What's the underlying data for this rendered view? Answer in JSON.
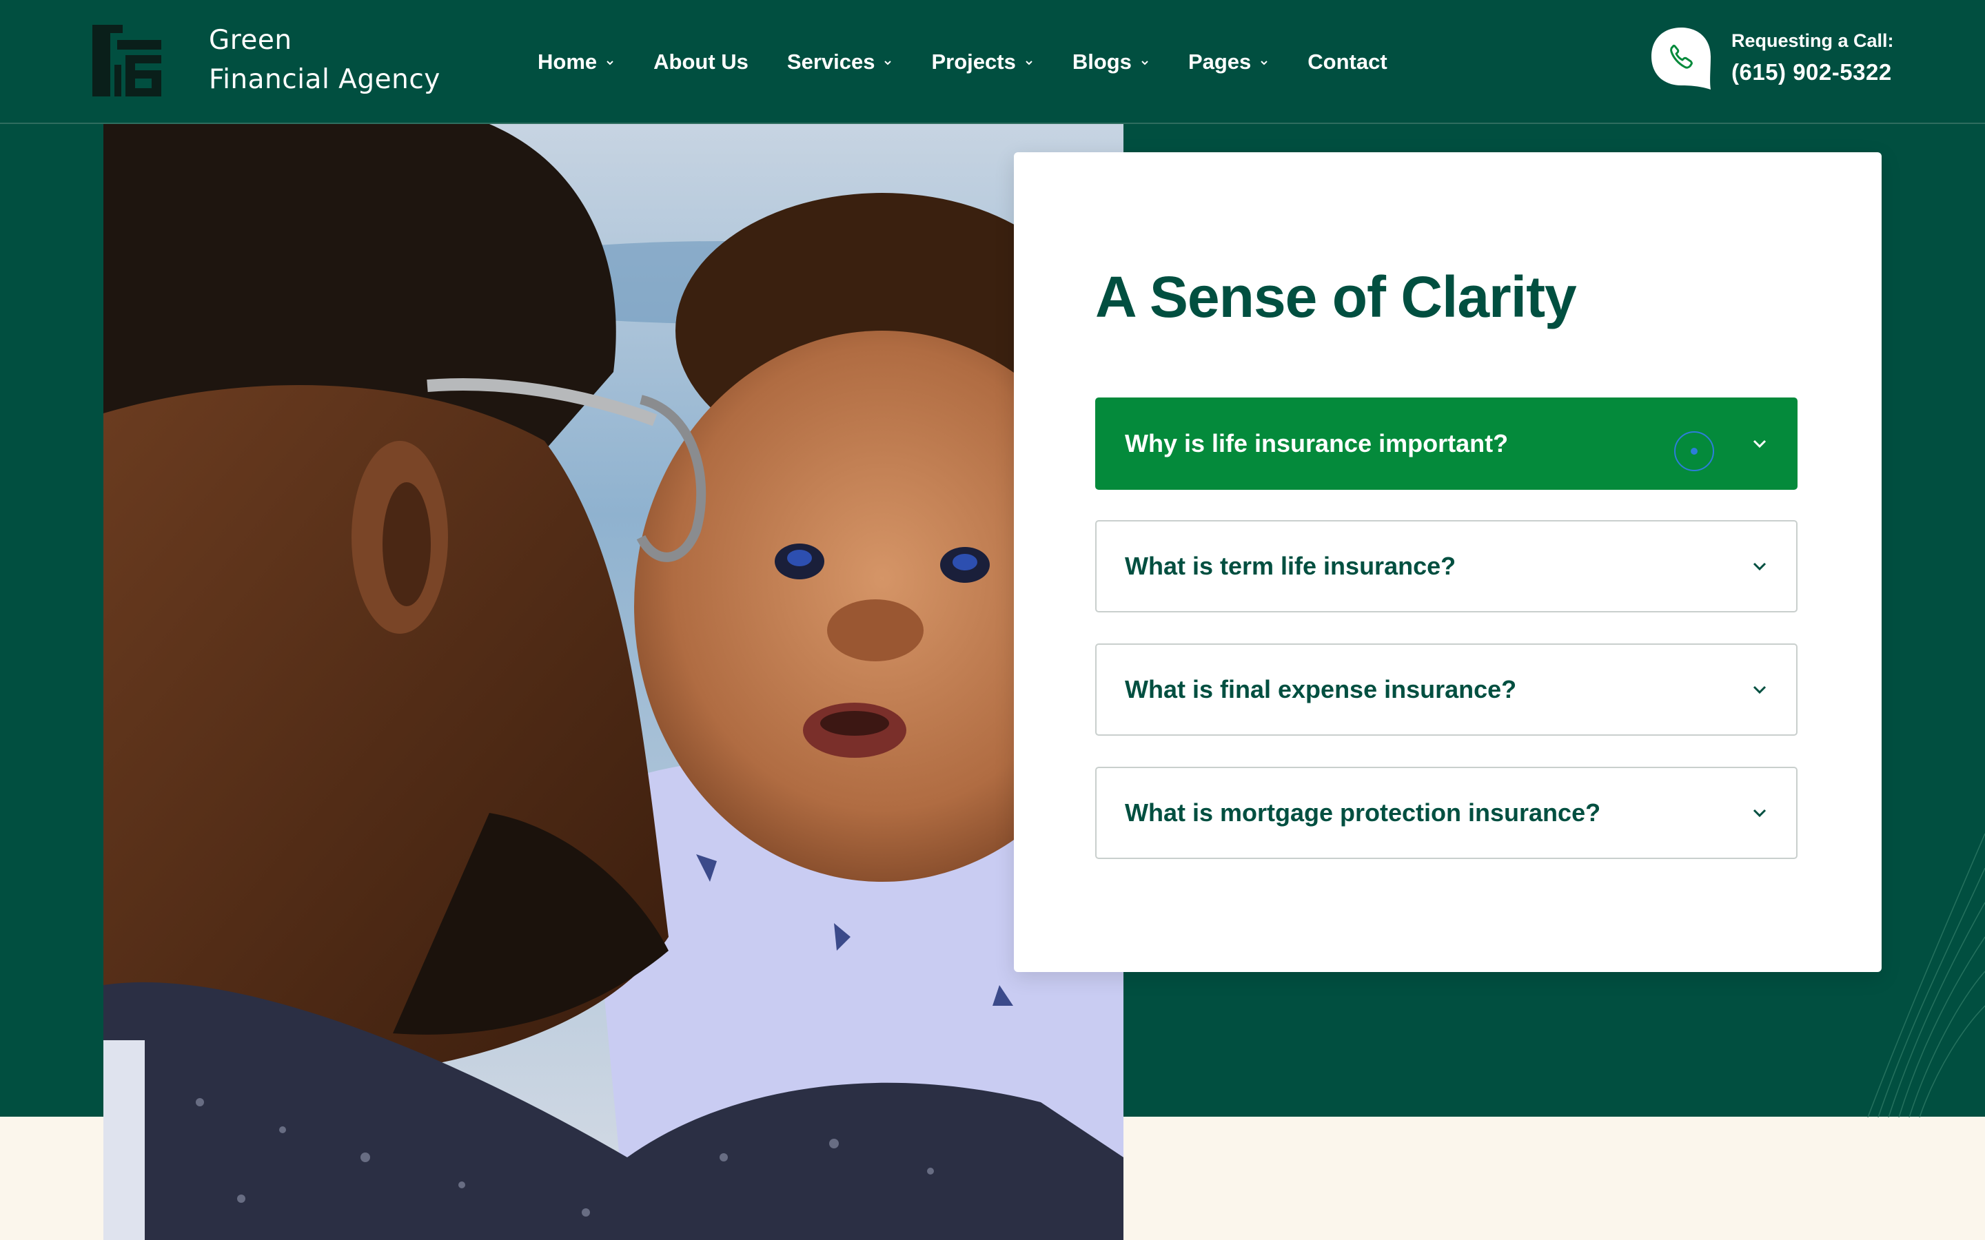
{
  "brand": {
    "name_line1": "Green",
    "name_line2": "Financial Agency",
    "logo_icon": "logo-mark-icon"
  },
  "nav": {
    "items": [
      {
        "label": "Home",
        "has_dropdown": true
      },
      {
        "label": "About Us",
        "has_dropdown": false
      },
      {
        "label": "Services",
        "has_dropdown": true
      },
      {
        "label": "Projects",
        "has_dropdown": true
      },
      {
        "label": "Blogs",
        "has_dropdown": true
      },
      {
        "label": "Pages",
        "has_dropdown": true
      },
      {
        "label": "Contact",
        "has_dropdown": false
      }
    ]
  },
  "call": {
    "label": "Requesting a Call:",
    "number": "(615) 902-5322",
    "icon": "phone-icon"
  },
  "faq_section": {
    "title": "A Sense of Clarity",
    "items": [
      {
        "question": "Why is life insurance important?",
        "active": true
      },
      {
        "question": "What is term life insurance?",
        "active": false
      },
      {
        "question": "What is final expense insurance?",
        "active": false
      },
      {
        "question": "What is mortgage protection insurance?",
        "active": false
      }
    ]
  },
  "colors": {
    "primary_dark_green": "#014f40",
    "accent_green": "#048a3b",
    "cream": "#fbf6ec",
    "white": "#ffffff"
  }
}
